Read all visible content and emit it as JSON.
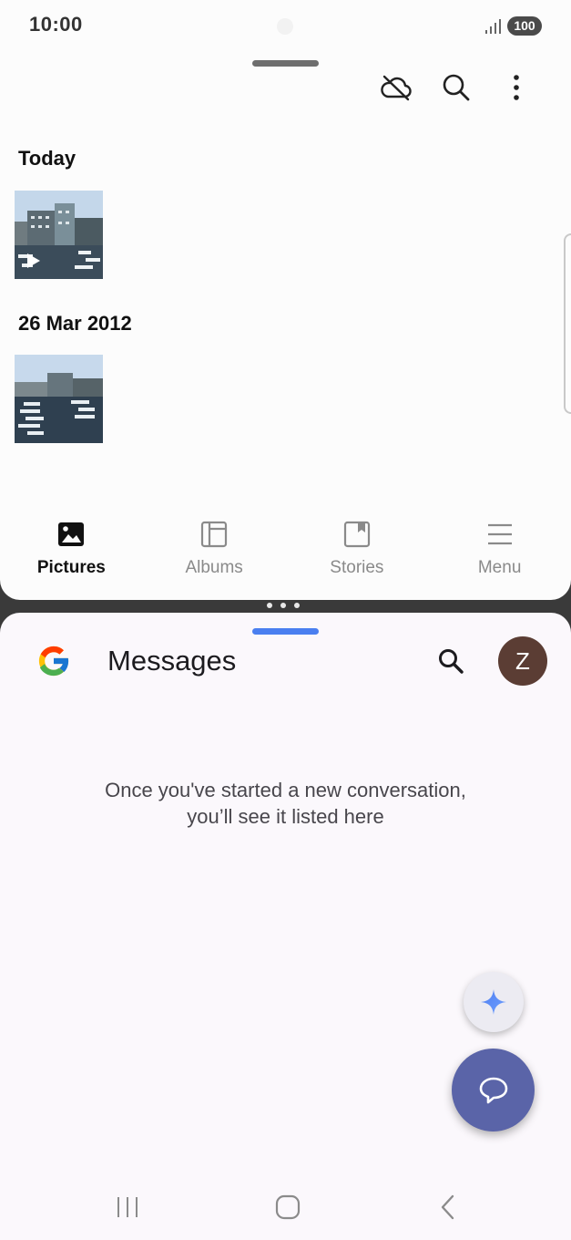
{
  "status_bar": {
    "time": "10:00",
    "battery": "100"
  },
  "gallery": {
    "sections": [
      {
        "title": "Today",
        "thumb_kind": "video"
      },
      {
        "title": "26 Mar 2012",
        "thumb_kind": "photo"
      }
    ],
    "actions": {
      "cloud_icon": "cloud-off-icon",
      "search_icon": "search-icon",
      "more_icon": "more-vert-icon"
    },
    "nav": [
      {
        "label": "Pictures",
        "icon": "image-icon",
        "active": true
      },
      {
        "label": "Albums",
        "icon": "album-icon",
        "active": false
      },
      {
        "label": "Stories",
        "icon": "stories-icon",
        "active": false
      },
      {
        "label": "Menu",
        "icon": "menu-icon",
        "active": false
      }
    ]
  },
  "messages": {
    "title": "Messages",
    "avatar_letter": "Z",
    "empty_line1": "Once you've started a new conversation,",
    "empty_line2": "you’ll see it listed here",
    "colors": {
      "accent": "#5a64a8",
      "handle": "#4a7ff0",
      "avatar": "#5b3d34"
    }
  }
}
